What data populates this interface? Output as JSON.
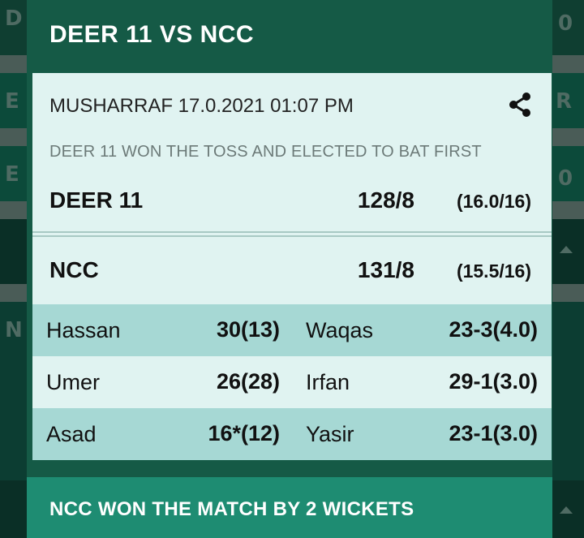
{
  "background": {
    "left_letters": [
      "D",
      "E",
      "E",
      "N"
    ],
    "right_letters": [
      "0",
      "R",
      "0"
    ]
  },
  "dialog": {
    "title": "DEER 11 VS NCC",
    "meta": "MUSHARRAF  17.0.2021 01:07 PM",
    "share_icon": "share-icon",
    "toss": "DEER 11 WON THE TOSS AND ELECTED TO BAT FIRST",
    "teams": [
      {
        "name": "DEER 11",
        "score": "128/8",
        "overs": "(16.0/16)"
      },
      {
        "name": "NCC",
        "score": "131/8",
        "overs": "(15.5/16)"
      }
    ],
    "performances": [
      {
        "batter": "Hassan",
        "bat_score": "30(13)",
        "bowler": "Waqas",
        "bowl_figures": "23-3(4.0)"
      },
      {
        "batter": "Umer",
        "bat_score": "26(28)",
        "bowler": "Irfan",
        "bowl_figures": "29-1(3.0)"
      },
      {
        "batter": "Asad",
        "bat_score": "16*(12)",
        "bowler": "Yasir",
        "bowl_figures": "23-1(3.0)"
      }
    ],
    "result": "NCC WON THE MATCH BY 2 WICKETS"
  },
  "colors": {
    "dialog_bg": "#155a46",
    "card_bg": "#e0f3f1",
    "row_highlight": "#a6d8d4",
    "result_bar": "#1e8c72"
  }
}
